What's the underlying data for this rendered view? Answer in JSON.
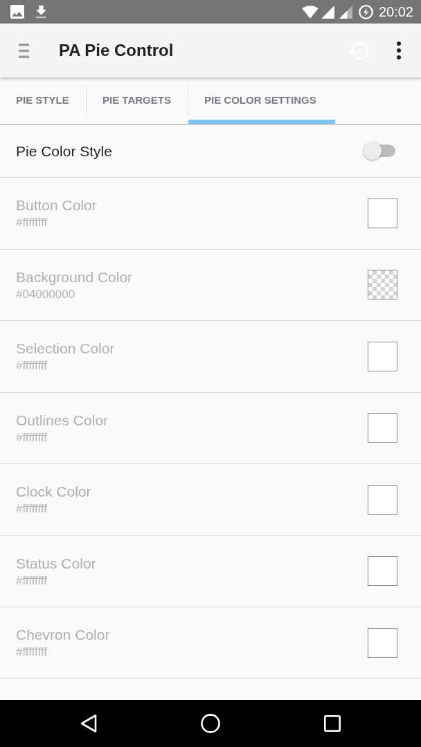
{
  "status_bar": {
    "time": "20:02"
  },
  "toolbar": {
    "title": "PA Pie Control"
  },
  "tabs": [
    {
      "label": "PIE STYLE",
      "selected": false
    },
    {
      "label": "PIE TARGETS",
      "selected": false
    },
    {
      "label": "PIE COLOR SETTINGS",
      "selected": true
    }
  ],
  "settings": [
    {
      "kind": "switch",
      "title": "Pie Color Style",
      "on": false
    },
    {
      "kind": "color",
      "title": "Button Color",
      "value": "#ffffffff",
      "disabled": true,
      "transparent": false,
      "color": "#ffffff"
    },
    {
      "kind": "color",
      "title": "Background Color",
      "value": "#04000000",
      "disabled": true,
      "transparent": true
    },
    {
      "kind": "color",
      "title": "Selection Color",
      "value": "#ffffffff",
      "disabled": true,
      "transparent": false,
      "color": "#ffffff"
    },
    {
      "kind": "color",
      "title": "Outlines Color",
      "value": "#ffffffff",
      "disabled": true,
      "transparent": false,
      "color": "#ffffff"
    },
    {
      "kind": "color",
      "title": "Clock Color",
      "value": "#ffffffff",
      "disabled": true,
      "transparent": false,
      "color": "#ffffff"
    },
    {
      "kind": "color",
      "title": "Status Color",
      "value": "#ffffffff",
      "disabled": true,
      "transparent": false,
      "color": "#ffffff"
    },
    {
      "kind": "color",
      "title": "Chevron Color",
      "value": "#ffffffff",
      "disabled": true,
      "transparent": false,
      "color": "#ffffff"
    }
  ]
}
